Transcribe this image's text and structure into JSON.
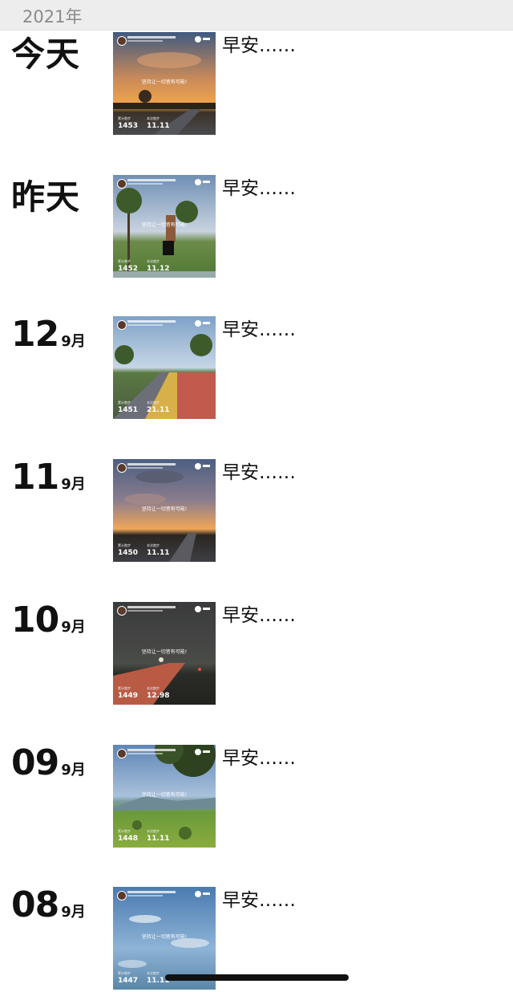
{
  "header": {
    "year": "2021年"
  },
  "entries": [
    {
      "day": "今天",
      "month": "",
      "caption": "早安……",
      "photo": "sunset-road",
      "count": "1453",
      "dist": "11.11"
    },
    {
      "day": "昨天",
      "month": "",
      "caption": "早安……",
      "photo": "runner-park",
      "count": "1452",
      "dist": "11.12"
    },
    {
      "day": "12",
      "month": "9月",
      "caption": "早安……",
      "photo": "red-track",
      "count": "1451",
      "dist": "21.11"
    },
    {
      "day": "11",
      "month": "9月",
      "caption": "早安……",
      "photo": "dusk-clouds",
      "count": "1450",
      "dist": "11.11"
    },
    {
      "day": "10",
      "month": "9月",
      "caption": "早安……",
      "photo": "night-road",
      "count": "1449",
      "dist": "12.98"
    },
    {
      "day": "09",
      "month": "9月",
      "caption": "早安……",
      "photo": "green-hills",
      "count": "1448",
      "dist": "11.11"
    },
    {
      "day": "08",
      "month": "9月",
      "caption": "早安……",
      "photo": "blue-sky",
      "count": "1447",
      "dist": "11.11"
    }
  ],
  "colors": {
    "header_bg": "#ededed",
    "year_text": "#8a8a8a"
  }
}
